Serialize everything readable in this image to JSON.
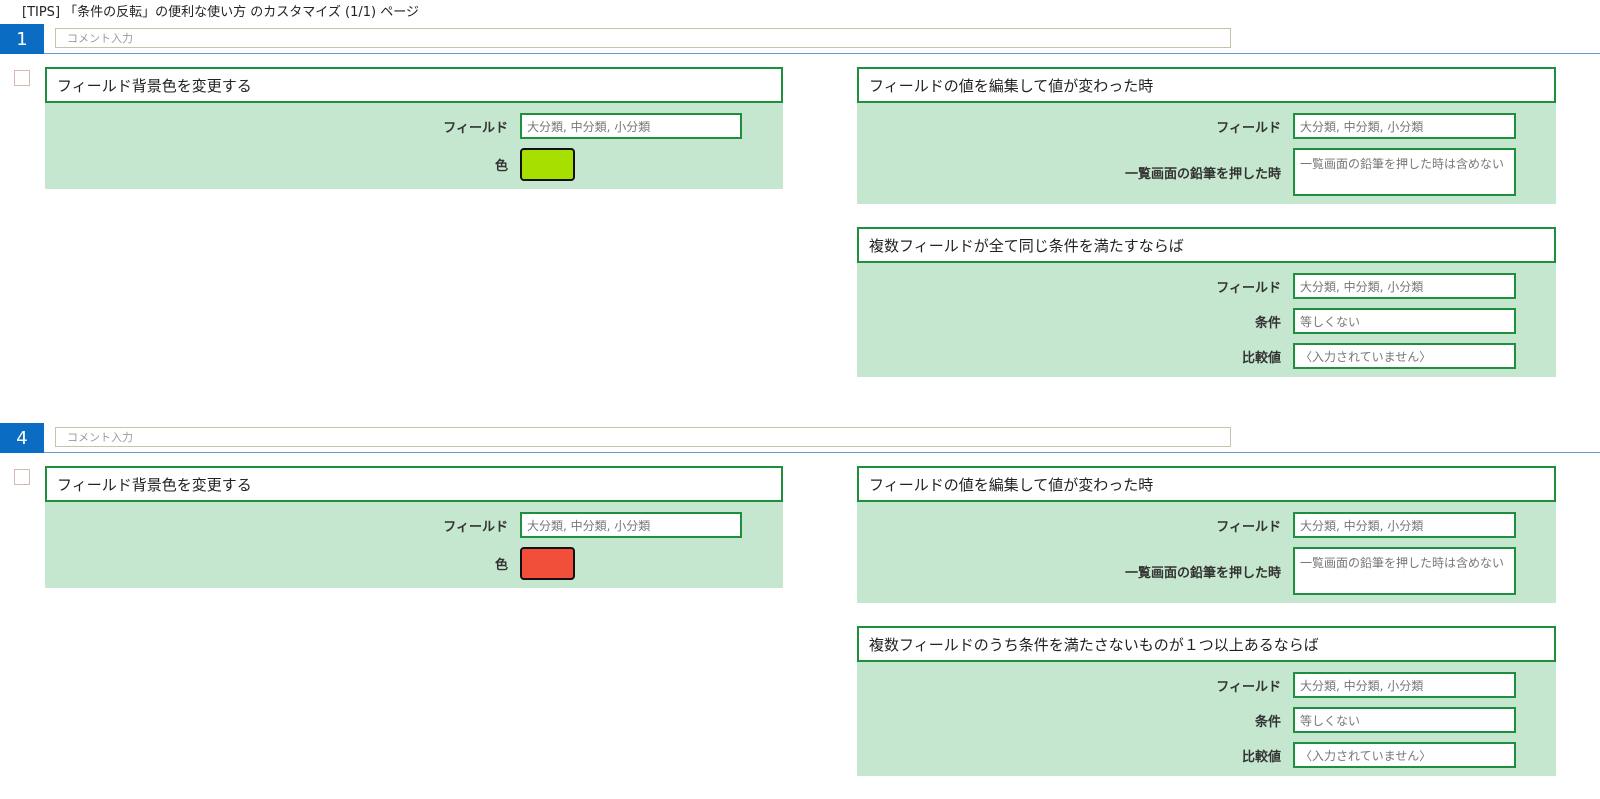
{
  "page": {
    "title": "[TIPS] 「条件の反転」の便利な使い方 のカスタマイズ (1/1) ページ"
  },
  "sections": [
    {
      "number": "1",
      "comment_placeholder": "コメント入力",
      "action": {
        "title": "フィールド背景色を変更する",
        "field_label": "フィールド",
        "field_value": "大分類, 中分類, 小分類",
        "color_label": "色",
        "color": "#a7df00"
      },
      "trigger": {
        "title": "フィールドの値を編集して値が変わった時",
        "field_label": "フィールド",
        "field_value": "大分類, 中分類, 小分類",
        "pencil_label": "一覧画面の鉛筆を押した時",
        "pencil_value": "一覧画面の鉛筆を押した時は含めない"
      },
      "condition": {
        "title": "複数フィールドが全て同じ条件を満たすならば",
        "field_label": "フィールド",
        "field_value": "大分類, 中分類, 小分類",
        "cond_label": "条件",
        "cond_value": "等しくない",
        "compare_label": "比較値",
        "compare_value": "〈入力されていません〉"
      }
    },
    {
      "number": "4",
      "comment_placeholder": "コメント入力",
      "action": {
        "title": "フィールド背景色を変更する",
        "field_label": "フィールド",
        "field_value": "大分類, 中分類, 小分類",
        "color_label": "色",
        "color": "#f24f3b"
      },
      "trigger": {
        "title": "フィールドの値を編集して値が変わった時",
        "field_label": "フィールド",
        "field_value": "大分類, 中分類, 小分類",
        "pencil_label": "一覧画面の鉛筆を押した時",
        "pencil_value": "一覧画面の鉛筆を押した時は含めない"
      },
      "condition": {
        "title": "複数フィールドのうち条件を満たさないものが１つ以上あるならば",
        "field_label": "フィールド",
        "field_value": "大分類, 中分類, 小分類",
        "cond_label": "条件",
        "cond_value": "等しくない",
        "compare_label": "比較値",
        "compare_value": "〈入力されていません〉"
      }
    }
  ]
}
